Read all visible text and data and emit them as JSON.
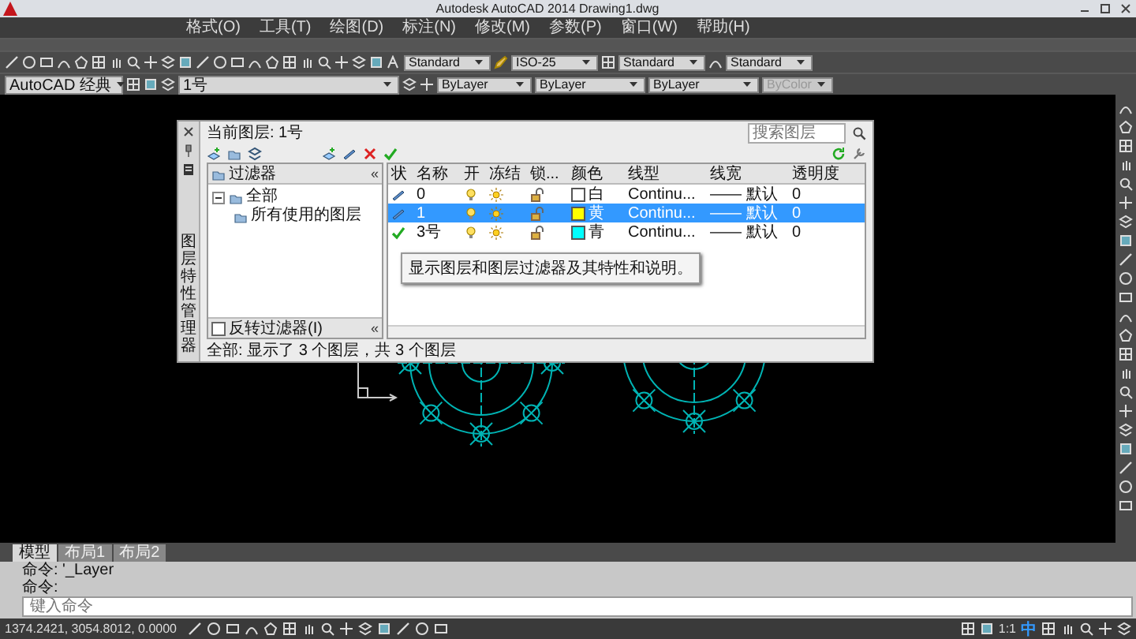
{
  "window": {
    "title": "Autodesk AutoCAD 2014",
    "document": "Drawing1.dwg"
  },
  "menu": [
    "格式(O)",
    "工具(T)",
    "绘图(D)",
    "标注(N)",
    "修改(M)",
    "参数(P)",
    "窗口(W)",
    "帮助(H)"
  ],
  "styles_toolbar": {
    "text_style": "Standard",
    "dim_style": "ISO-25",
    "table_style": "Standard",
    "multileader_style": "Standard"
  },
  "properties_toolbar": {
    "workspace": "AutoCAD 经典",
    "layer": "1号",
    "color_setting": "ByLayer",
    "linetype": "ByLayer",
    "lineweight": "ByLayer",
    "plot_style": {
      "value": "ByColor",
      "disabled": true
    }
  },
  "layer_manager": {
    "side_title": "图层特性管理器",
    "current_layer": "当前图层: 1号",
    "search": {
      "placeholder": "搜索图层"
    },
    "filters_header": "过滤器",
    "collapse_symbols": [
      "«",
      "«"
    ],
    "filter_tree": [
      {
        "label": "全部",
        "expanded": true,
        "children": [
          {
            "label": "所有使用的图层"
          }
        ]
      }
    ],
    "invert_filter": {
      "label": "反转过滤器(I)",
      "checked": false
    },
    "columns": [
      "状",
      "名称",
      "开",
      "冻结",
      "锁...",
      "颜色",
      "线型",
      "线宽",
      "透明度"
    ],
    "layers": [
      {
        "name": "0",
        "current": false,
        "on": true,
        "frozen": false,
        "locked": false,
        "color": "#ffffff",
        "color_name": "白",
        "linetype": "Continu...",
        "lineweight": "—— 默认",
        "transparency": "0",
        "selected": false
      },
      {
        "name": "1",
        "current": false,
        "on": true,
        "frozen": false,
        "locked": false,
        "color": "#ffff00",
        "color_name": "黄",
        "linetype": "Continu...",
        "lineweight": "—— 默认",
        "transparency": "0",
        "selected": true
      },
      {
        "name": "3号",
        "current": true,
        "on": true,
        "frozen": false,
        "locked": false,
        "color": "#00ffff",
        "color_name": "青",
        "linetype": "Continu...",
        "lineweight": "—— 默认",
        "transparency": "0",
        "selected": false
      }
    ],
    "tooltip": "显示图层和图层过滤器及其特性和说明。",
    "status": "全部: 显示了 3 个图层，共 3 个图层"
  },
  "layout_tabs": [
    {
      "label": "模型",
      "selected": true
    },
    {
      "label": "布局1",
      "selected": false
    },
    {
      "label": "布局2",
      "selected": false
    }
  ],
  "command_history": [
    "命令: '_Layer",
    "命令:"
  ],
  "command_input": {
    "placeholder": "键入命令"
  },
  "status_bar": {
    "coordinates": "1374.2421, 3054.8012, 0.0000",
    "annotation_scale": "1:1",
    "ime": "中"
  }
}
